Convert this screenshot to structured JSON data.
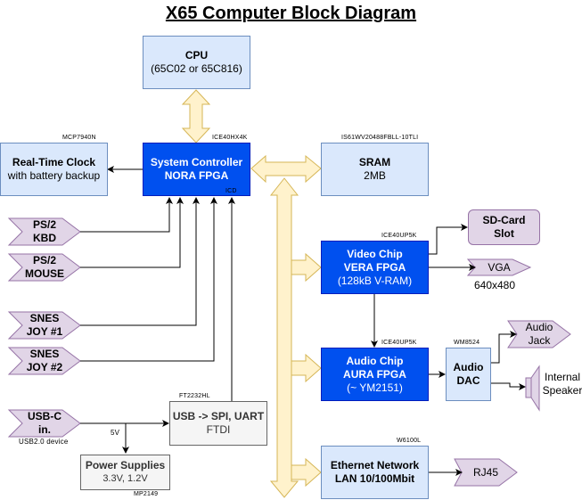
{
  "title": "X65 Computer Block Diagram",
  "blocks": {
    "cpu": {
      "title": "CPU",
      "subtitle": "(65C02 or 65C816)"
    },
    "rtc": {
      "title": "Real-Time Clock",
      "subtitle": "with battery backup",
      "part": "MCP7940N"
    },
    "nora": {
      "title": "System Controller",
      "subtitle": "NORA FPGA",
      "part": "ICE40HX4K",
      "note": "ICD"
    },
    "sram": {
      "title": "SRAM",
      "subtitle": "2MB",
      "part": "IS61WV20488FBLL-10TLI"
    },
    "vera": {
      "title": "Video Chip",
      "subtitle": "VERA FPGA",
      "detail": "(128kB V-RAM)",
      "part": "ICE40UP5K"
    },
    "sdcard": {
      "title": "SD-Card",
      "subtitle": "Slot"
    },
    "aura": {
      "title": "Audio Chip",
      "subtitle": "AURA FPGA",
      "detail": "(~ YM2151)",
      "part": "ICE40UP5K"
    },
    "dac": {
      "title": "Audio",
      "subtitle": "DAC",
      "part": "WM8524"
    },
    "ftdi": {
      "title": "USB -> SPI, UART",
      "subtitle": "FTDI",
      "part": "FT2232HL"
    },
    "power": {
      "title": "Power Supplies",
      "subtitle": "3.3V, 1.2V",
      "part": "MP2149"
    },
    "ethernet": {
      "title": "Ethernet Network",
      "subtitle": "LAN 10/100Mbit",
      "part": "W6100L"
    }
  },
  "ports": {
    "ps2kbd": {
      "line1": "PS/2",
      "line2": "KBD"
    },
    "ps2mouse": {
      "line1": "PS/2",
      "line2": "MOUSE"
    },
    "snes1": {
      "line1": "SNES",
      "line2": "JOY #1"
    },
    "snes2": {
      "line1": "SNES",
      "line2": "JOY #2"
    },
    "usbc": {
      "line1": "USB-C",
      "line2": "in.",
      "note": "USB2.0 device"
    },
    "vga": {
      "label": "VGA",
      "note": "640x480"
    },
    "audiojack": {
      "line1": "Audio",
      "line2": "Jack"
    },
    "rj45": {
      "label": "RJ45"
    }
  },
  "speaker": {
    "line1": "Internal",
    "line2": "Speaker"
  },
  "labels": {
    "usb_power": "5V"
  },
  "colors": {
    "blue_fill": "#0050ef",
    "light_fill": "#dae8fc",
    "purple_fill": "#e1d5e7",
    "bus_fill": "#fff2cc",
    "bus_stroke": "#d6b656"
  }
}
